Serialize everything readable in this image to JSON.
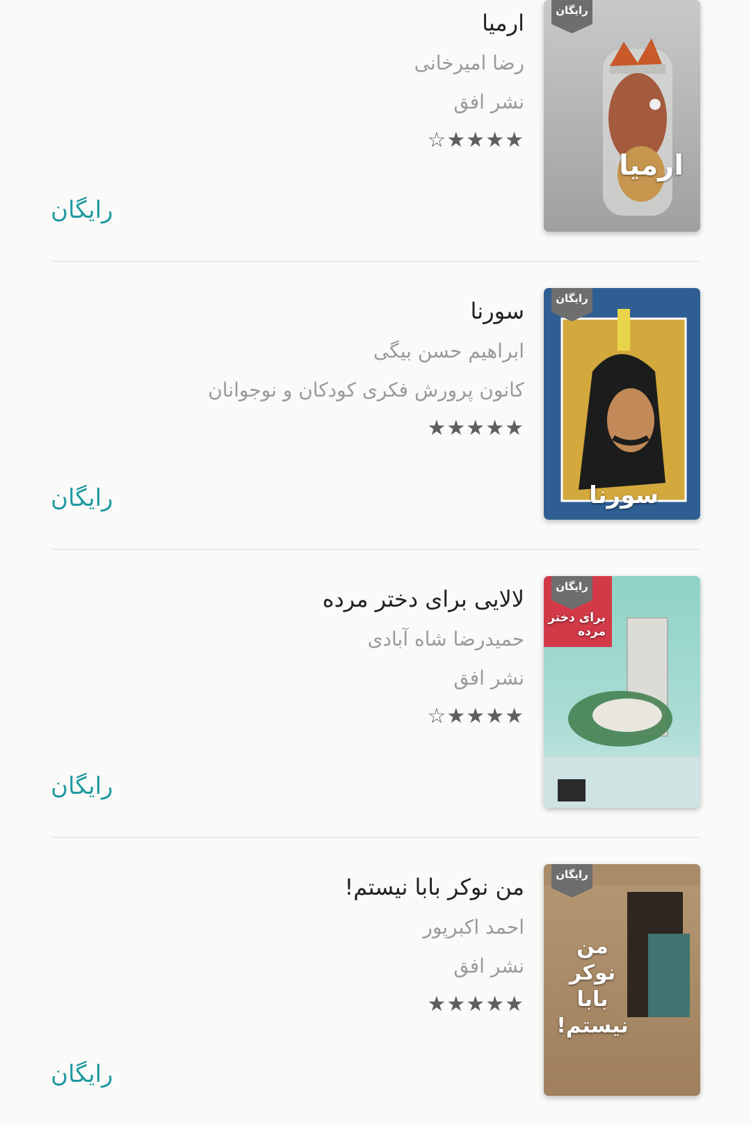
{
  "badge_label": "رایگان",
  "price_color": "#1f9aa0",
  "books": [
    {
      "title": "ارمیا",
      "author": "رضا امیرخانی",
      "publisher": "نشر افق",
      "rating_stars": "☆★★★★",
      "rating": 4,
      "price": "رایگان",
      "cover_title": "ارمیا"
    },
    {
      "title": "سورنا",
      "author": "ابراهیم  حسن بیگی",
      "publisher": "کانون پرورش فکری کودکان و نوجوانان",
      "rating_stars": "★★★★★",
      "rating": 5,
      "price": "رایگان",
      "cover_title": "سورنا"
    },
    {
      "title": "لالایی برای دختر مرده",
      "author": "حمیدرضا شاه آبادی",
      "publisher": "نشر افق",
      "rating_stars": "☆★★★★",
      "rating": 4,
      "price": "رایگان",
      "cover_title": "برای دختر مرده"
    },
    {
      "title": "من نوکر بابا نیستم!",
      "author": "احمد اکبرپور",
      "publisher": "نشر افق",
      "rating_stars": "★★★★★",
      "rating": 5,
      "price": "رایگان",
      "cover_title": "من نوکر بابا نیستم!"
    }
  ]
}
